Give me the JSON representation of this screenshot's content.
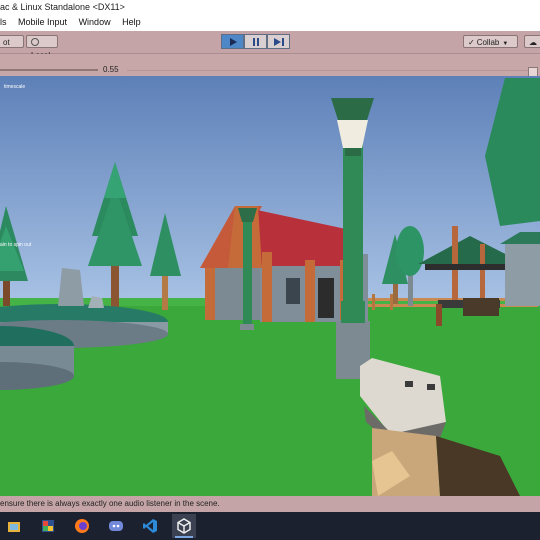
{
  "window": {
    "title": "ac & Linux Standalone <DX11>"
  },
  "menu": {
    "items": [
      "ls",
      "Mobile Input",
      "Window",
      "Help"
    ]
  },
  "toolbar": {
    "pivot_label": "ot",
    "local_label": "Local",
    "collab_label": "Collab",
    "play_active": true
  },
  "game_view": {
    "timescale_value": "0.55",
    "timescale_fraction": 0.55,
    "overlay_top": "timescale",
    "overlay_mid": "ain to spin out"
  },
  "status": {
    "message": "ensure there is always exactly one audio listener in the scene."
  },
  "taskbar": {
    "icons": [
      "file-explorer-icon",
      "paint-icon",
      "firefox-icon",
      "discord-icon",
      "vscode-icon",
      "unity-icon"
    ]
  },
  "colors": {
    "toolbar": "#c4a4a6",
    "sky": "#86a8d6",
    "grass": "#3aa83a",
    "play_blue": "#4d87c7"
  }
}
